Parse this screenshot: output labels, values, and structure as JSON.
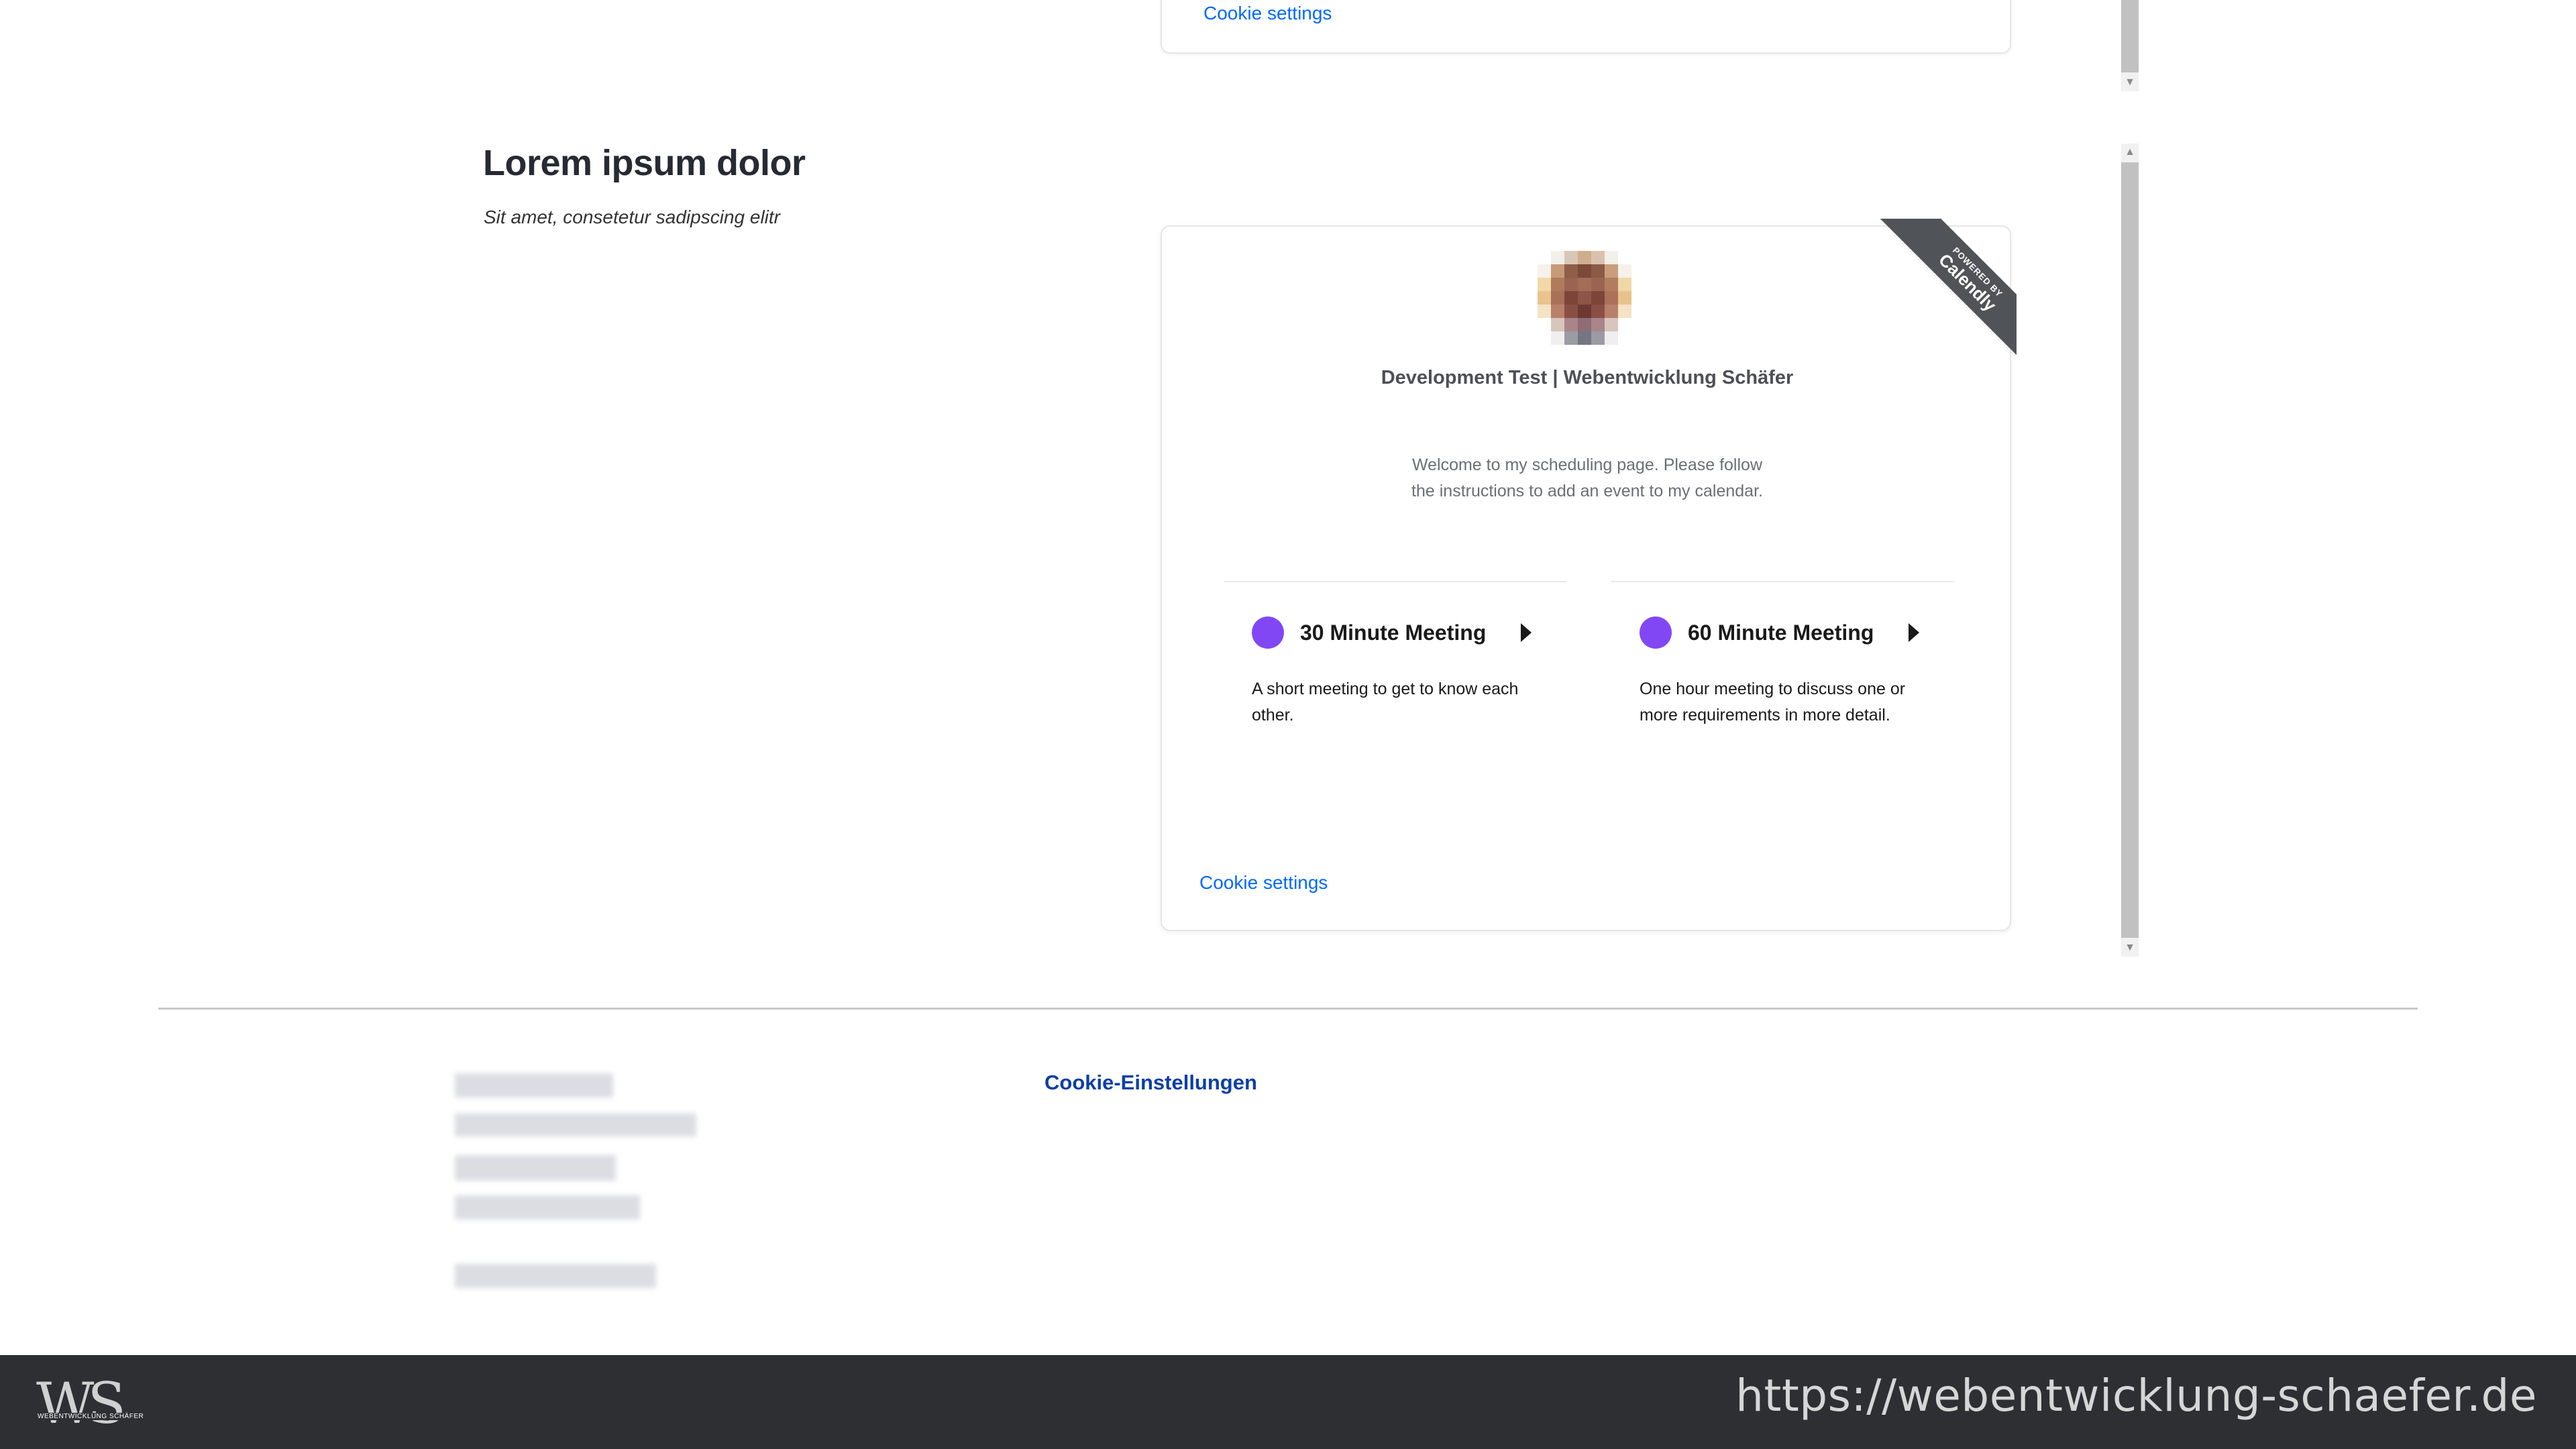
{
  "top_embed": {
    "cookie_label": "Cookie settings"
  },
  "section": {
    "heading": "Lorem ipsum dolor",
    "subheading": "Sit amet, consetetur sadipscing elitr"
  },
  "calendly": {
    "ribbon_small": "POWERED BY",
    "ribbon_brand": "Calendly",
    "org_name": "Development Test | Webentwicklung Schäfer",
    "welcome": "Welcome to my scheduling page. Please follow the instructions to add an event to my calendar.",
    "events": [
      {
        "title": "30 Minute Meeting",
        "description": "A short meeting to get to know each other.",
        "color": "#8247f5"
      },
      {
        "title": "60 Minute Meeting",
        "description": "One hour meeting to discuss one or more requirements in more detail.",
        "color": "#8247f5"
      }
    ],
    "cookie_label": "Cookie settings"
  },
  "footer": {
    "cookie_einstellungen": "Cookie-Einstellungen"
  },
  "bottom_bar": {
    "logo_text": "WS",
    "logo_tagline": "WEBENTWICKLUNG SCHÄFER",
    "url": "https://webentwicklung-schaefer.de"
  },
  "colors": {
    "link": "#0069ff",
    "event_dot": "#8247f5",
    "bottom_bar": "#2d2f33"
  }
}
